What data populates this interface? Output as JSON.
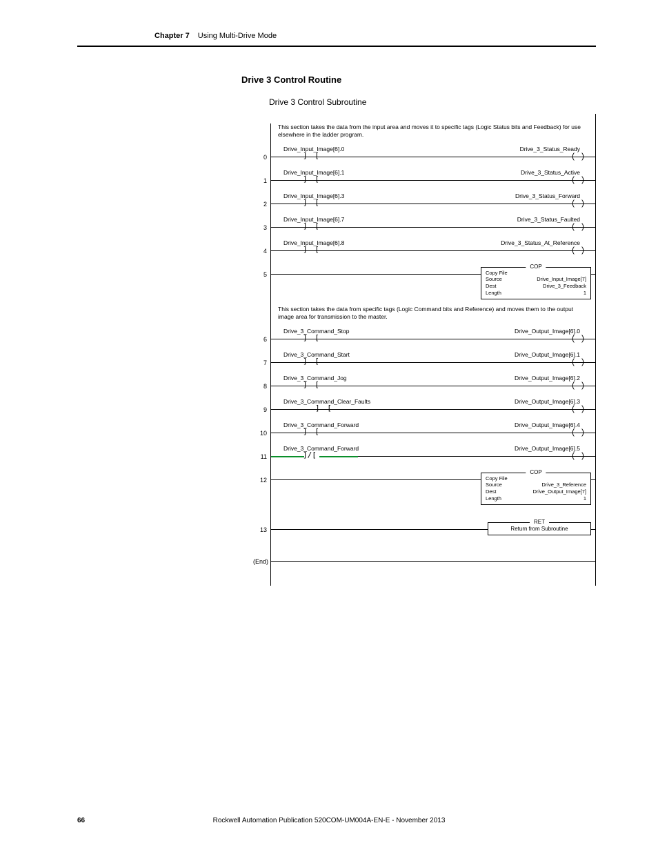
{
  "header": {
    "chapter": "Chapter 7",
    "title": "Using Multi-Drive Mode"
  },
  "section_heading": "Drive 3 Control Routine",
  "subroutine_title": "Drive 3 Control Subroutine",
  "desc1": "This section takes the data from the input area and moves it to specific tags (Logic Status bits and Feedback) for use elsewhere in the ladder program.",
  "desc2": "This section takes the data from specific tags (Logic Command bits and Reference) and moves them to the output image area for transmission to the master.",
  "rungs": [
    {
      "n": "0",
      "left": "Drive_Input_Image[6].0",
      "right": "Drive_3_Status_Ready",
      "type": "xic-ote"
    },
    {
      "n": "1",
      "left": "Drive_Input_Image[6].1",
      "right": "Drive_3_Status_Active",
      "type": "xic-ote"
    },
    {
      "n": "2",
      "left": "Drive_Input_Image[6].3",
      "right": "Drive_3_Status_Forward",
      "type": "xic-ote"
    },
    {
      "n": "3",
      "left": "Drive_Input_Image[6].7",
      "right": "Drive_3_Status_Faulted",
      "type": "xic-ote"
    },
    {
      "n": "4",
      "left": "Drive_Input_Image[6].8",
      "right": "Drive_3_Status_At_Reference",
      "type": "xic-ote"
    },
    {
      "n": "5",
      "type": "cop",
      "cop_title": "COP",
      "cop_name": "Copy File",
      "rows": [
        [
          "Source",
          "Drive_Input_Image[7]"
        ],
        [
          "Dest",
          "Drive_3_Feedback"
        ],
        [
          "Length",
          "1"
        ]
      ]
    },
    {
      "n": "6",
      "left": "Drive_3_Command_Stop",
      "right": "Drive_Output_Image[6].0",
      "type": "xic-ote"
    },
    {
      "n": "7",
      "left": "Drive_3_Command_Start",
      "right": "Drive_Output_Image[6].1",
      "type": "xic-ote"
    },
    {
      "n": "8",
      "left": "Drive_3_Command_Jog",
      "right": "Drive_Output_Image[6].2",
      "type": "xic-ote"
    },
    {
      "n": "9",
      "left": "Drive_3_Command_Clear_Faults",
      "right": "Drive_Output_Image[6].3",
      "type": "xic-ote"
    },
    {
      "n": "10",
      "left": "Drive_3_Command_Forward",
      "right": "Drive_Output_Image[6].4",
      "type": "xic-ote"
    },
    {
      "n": "11",
      "left": "Drive_3_Command_Forward",
      "right": "Drive_Output_Image[6].5",
      "type": "xio-ote"
    },
    {
      "n": "12",
      "type": "cop",
      "cop_title": "COP",
      "cop_name": "Copy File",
      "rows": [
        [
          "Source",
          "Drive_3_Reference"
        ],
        [
          "Dest",
          "Drive_Output_Image[7]"
        ],
        [
          "Length",
          "1"
        ]
      ]
    },
    {
      "n": "13",
      "type": "ret",
      "ret_title": "RET",
      "ret_label": "Return from Subroutine"
    }
  ],
  "end_label": "(End)",
  "footer": {
    "page": "66",
    "publication": "Rockwell Automation Publication 520COM-UM004A-EN-E - November 2013"
  }
}
